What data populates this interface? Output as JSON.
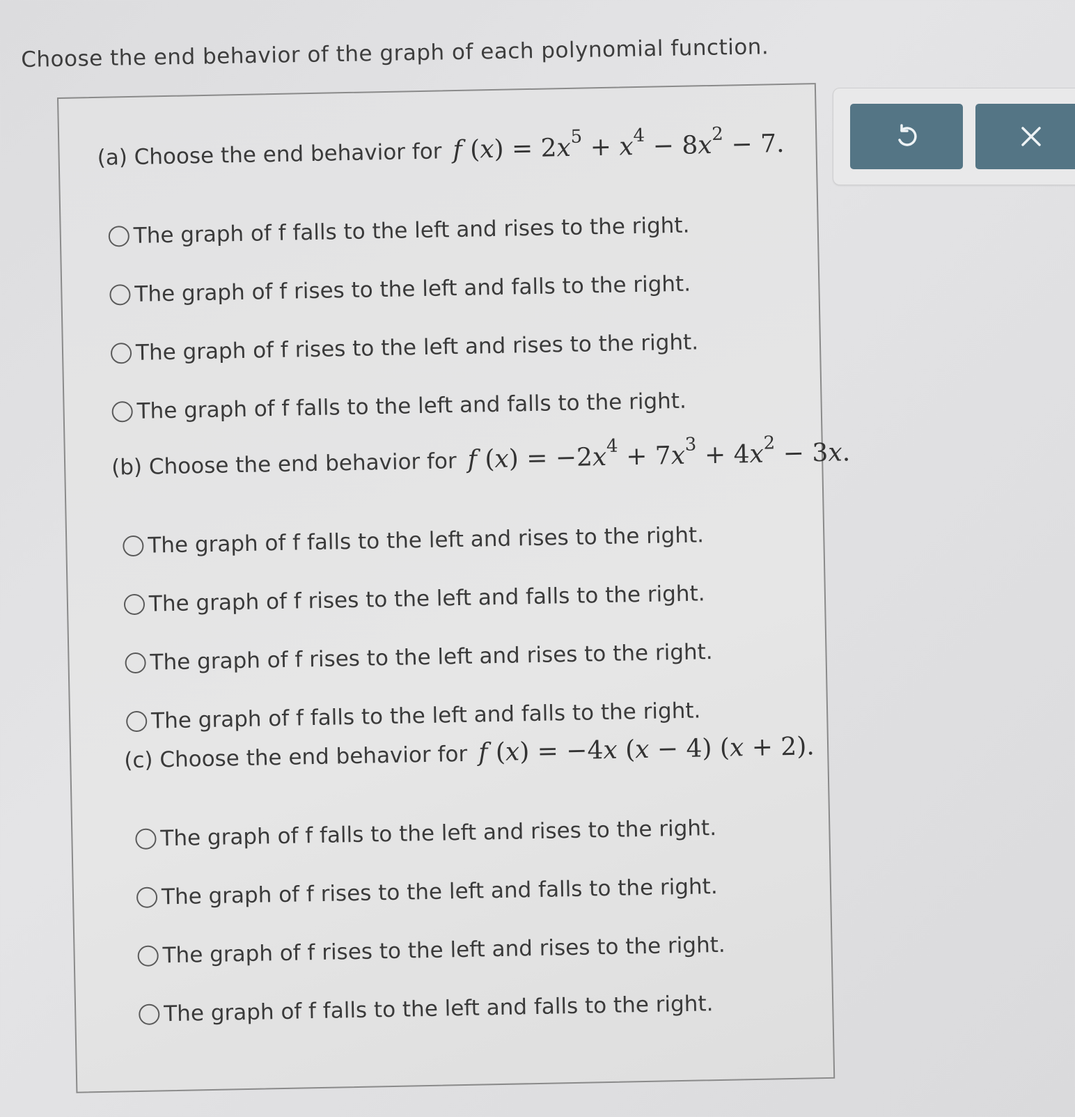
{
  "instruction": "Choose the end behavior of the graph of each polynomial function.",
  "toolbar": {
    "undo_icon": "undo-icon",
    "close_icon": "close-icon"
  },
  "parts": {
    "a": {
      "label": "(a) Choose the end behavior for",
      "function": "f(x) = 2x^5 + x^4 - 8x^2 - 7."
    },
    "b": {
      "label": "(b) Choose the end behavior for",
      "function": "f(x) = -2x^4 + 7x^3 + 4x^2 - 3x."
    },
    "c": {
      "label": "(c) Choose the end behavior for",
      "function": "f(x) = -4x(x - 4)(x + 2)."
    }
  },
  "options": [
    "The graph of f falls to the left and rises to the right.",
    "The graph of f rises to the left and falls to the right.",
    "The graph of f rises to the left and rises to the right.",
    "The graph of f falls to the left and falls to the right."
  ]
}
